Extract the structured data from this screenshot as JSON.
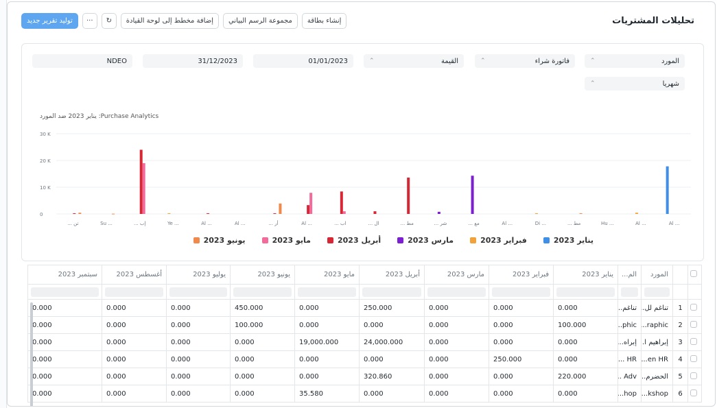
{
  "header": {
    "title": "تحليلات المشتريات",
    "buttons": {
      "create_card": "إنشاء بطاقة",
      "chart_group": "مجموعة الرسم البياني",
      "add_to_dashboard": "إضافة مخطط إلى لوحة القيادة",
      "refresh": "↻",
      "more": "···",
      "new_report": "توليد تقرير جديد"
    }
  },
  "filters": {
    "supplier": "المورد",
    "document": "فاتورة شراء",
    "value": "القيمة",
    "from_date": "01/01/2023",
    "to_date": "31/12/2023",
    "company": "NDEO",
    "period": "شهريا",
    "arrow": "⌃"
  },
  "chart_data": {
    "type": "bar",
    "title": "Purchase Analytics: يناير 2023 ضد المورد",
    "ylabel": "",
    "ylim": [
      0,
      30000
    ],
    "yticks": [
      "0",
      "10 K",
      "20 K",
      "30 K"
    ],
    "categories": [
      "... تن",
      "Su ...",
      "... إب",
      "Ye ...",
      "Al ...",
      "Al ...",
      "... أر",
      "Al ...",
      "... اب",
      "... ال",
      "... مط",
      "... شر",
      "... مع",
      "Al ...",
      "Di ...",
      "... مط",
      "Hu ...",
      "Al ...",
      "Al ..."
    ],
    "series": [
      {
        "name": "يناير 2023",
        "color": "#3f8fe8",
        "values": [
          0,
          0,
          0,
          0,
          0,
          0,
          0,
          0,
          0,
          0,
          0,
          0,
          0,
          0,
          0,
          0,
          0,
          0,
          17800
        ]
      },
      {
        "name": "فبراير 2023",
        "color": "#f0a23b",
        "values": [
          0,
          0,
          0,
          250,
          0,
          0,
          0,
          0,
          0,
          0,
          0,
          0,
          0,
          0,
          250,
          0,
          0,
          450,
          0
        ]
      },
      {
        "name": "مارس 2023",
        "color": "#7b1fd0",
        "values": [
          0,
          0,
          0,
          0,
          0,
          0,
          0,
          0,
          0,
          0,
          0,
          800,
          14300,
          0,
          0,
          0,
          0,
          0,
          0
        ]
      },
      {
        "name": "أبريل 2023",
        "color": "#d62834",
        "values": [
          250,
          0,
          24000,
          0,
          250,
          0,
          250,
          3300,
          8400,
          1000,
          13600,
          0,
          0,
          0,
          0,
          0,
          0,
          0,
          0
        ]
      },
      {
        "name": "مايو 2023",
        "color": "#f26b9a",
        "values": [
          0,
          0,
          19000,
          0,
          0,
          0,
          0,
          7900,
          1000,
          0,
          0,
          0,
          0,
          0,
          0,
          0,
          0,
          0,
          0
        ]
      },
      {
        "name": "يونيو 2023",
        "color": "#f0894c",
        "values": [
          450,
          100,
          0,
          0,
          0,
          0,
          3900,
          0,
          0,
          0,
          0,
          0,
          0,
          0,
          0,
          250,
          0,
          0,
          0
        ]
      }
    ]
  },
  "table": {
    "columns": [
      "المورد",
      "الم...",
      "يناير 2023",
      "فبراير 2023",
      "مارس 2023",
      "أبريل 2023",
      "مايو 2023",
      "يونيو 2023",
      "يوليو 2023",
      "أغسطس 2023",
      "سبتمبر 2023"
    ],
    "rows": [
      {
        "idx": "1",
        "supplier": "تناغم لل...",
        "name": "تناغم...",
        "values": [
          "0.000",
          "0.000",
          "0.000",
          "250.000",
          "0.000",
          "450.000",
          "0.000",
          "0.000",
          "0.000"
        ]
      },
      {
        "idx": "2",
        "supplier": "raphic...",
        "name": "phic...",
        "values": [
          "100.000",
          "0.000",
          "0.000",
          "0.000",
          "0.000",
          "100.000",
          "0.000",
          "0.000",
          "0.000"
        ]
      },
      {
        "idx": "3",
        "supplier": "إبراهيم ا...",
        "name": "إبراه...",
        "values": [
          "0.000",
          "0.000",
          "0.000",
          "24,000.000",
          "19,000.000",
          "0.000",
          "0.000",
          "0.000",
          "0.000"
        ]
      },
      {
        "idx": "4",
        "supplier": "en HR...",
        "name": "HR ...",
        "values": [
          "0.000",
          "250.000",
          "0.000",
          "0.000",
          "0.000",
          "0.000",
          "0.000",
          "0.000",
          "0.000"
        ]
      },
      {
        "idx": "5",
        "supplier": "الحضرم...",
        "name": "Adv ...",
        "values": [
          "220.000",
          "0.000",
          "0.000",
          "320.860",
          "0.000",
          "0.000",
          "0.000",
          "0.000",
          "0.000"
        ]
      },
      {
        "idx": "6",
        "supplier": "kshop...",
        "name": "hop...",
        "values": [
          "0.000",
          "0.000",
          "0.000",
          "0.000",
          "35.580",
          "0.000",
          "0.000",
          "0.000",
          "0.000"
        ]
      }
    ]
  }
}
